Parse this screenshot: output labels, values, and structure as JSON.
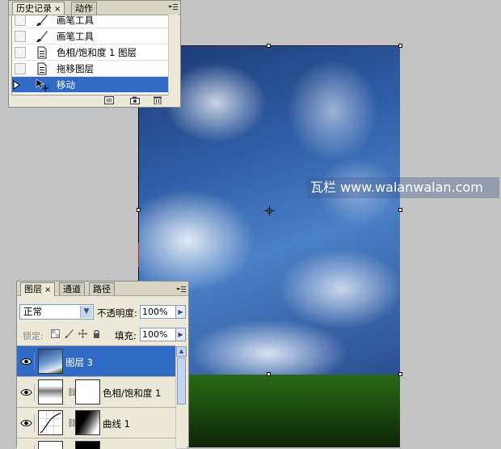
{
  "canvas": {
    "watermark": "瓦栏 www.walanwalan.com"
  },
  "history_panel": {
    "tabs": [
      {
        "label": "历史记录",
        "close": "×"
      },
      {
        "label": "动作"
      }
    ],
    "items": [
      {
        "label": "画笔工具",
        "icon": "brush-icon"
      },
      {
        "label": "画笔工具",
        "icon": "brush-icon"
      },
      {
        "label": "色相/饱和度 1 图层",
        "icon": "document-icon"
      },
      {
        "label": "拖移图层",
        "icon": "document-icon"
      },
      {
        "label": "移动",
        "icon": "move-icon",
        "selected": true
      }
    ],
    "footer_icons": [
      "new-document-from-state-icon",
      "new-snapshot-icon",
      "delete-icon"
    ]
  },
  "layers_panel": {
    "tabs": [
      {
        "label": "图层",
        "close": "×"
      },
      {
        "label": "通道"
      },
      {
        "label": "路径"
      }
    ],
    "blend_mode": "正常",
    "opacity_label": "不透明度:",
    "opacity_value": "100%",
    "lock_label": "锁定:",
    "fill_label": "填充:",
    "fill_value": "100%",
    "layers": [
      {
        "name": "图层 3",
        "selected": true
      },
      {
        "name": "色相/饱和度 1"
      },
      {
        "name": "曲线 1"
      }
    ]
  },
  "colors": {
    "selection": "#316ac5",
    "panel_bg": "#ece9d8",
    "workspace_bg": "#c3c3c3"
  }
}
